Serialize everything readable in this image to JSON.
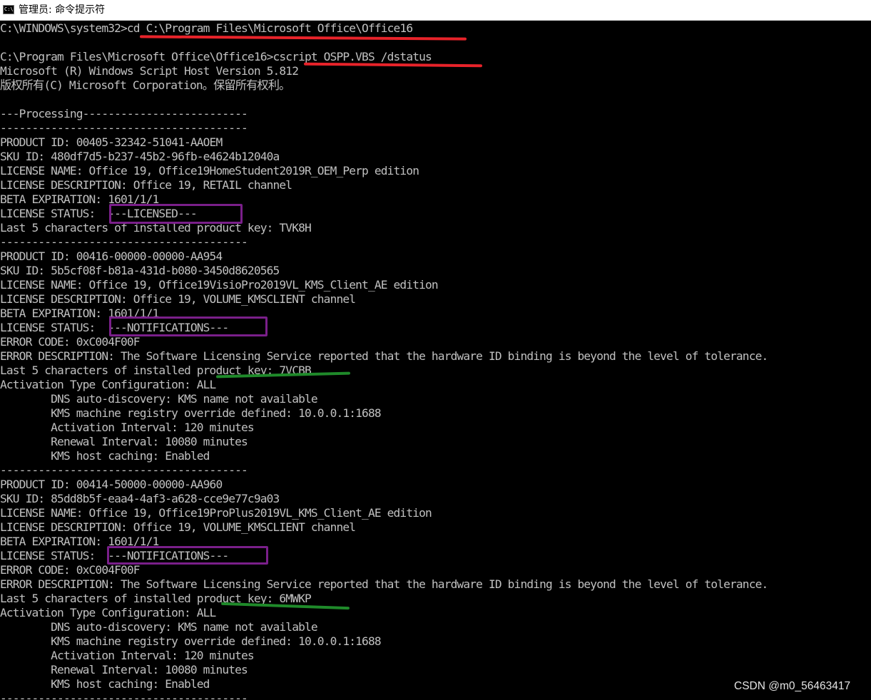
{
  "window": {
    "title": "管理员: 命令提示符",
    "icon_label": "C:\\.",
    "icon": "console-window-icon"
  },
  "console": {
    "lines": [
      "C:\\WINDOWS\\system32>cd C:\\Program Files\\Microsoft Office\\Office16",
      "",
      "C:\\Program Files\\Microsoft Office\\Office16>cscript OSPP.VBS /dstatus",
      "Microsoft (R) Windows Script Host Version 5.812",
      "版权所有(C) Microsoft Corporation。保留所有权利。",
      "",
      "---Processing--------------------------",
      "---------------------------------------",
      "PRODUCT ID: 00405-32342-51041-AAOEM",
      "SKU ID: 480df7d5-b237-45b2-96fb-e4624b12040a",
      "LICENSE NAME: Office 19, Office19HomeStudent2019R_OEM_Perp edition",
      "LICENSE DESCRIPTION: Office 19, RETAIL channel",
      "BETA EXPIRATION: 1601/1/1",
      "LICENSE STATUS:  ---LICENSED---",
      "Last 5 characters of installed product key: TVK8H",
      "---------------------------------------",
      "PRODUCT ID: 00416-00000-00000-AA954",
      "SKU ID: 5b5cf08f-b81a-431d-b080-3450d8620565",
      "LICENSE NAME: Office 19, Office19VisioPro2019VL_KMS_Client_AE edition",
      "LICENSE DESCRIPTION: Office 19, VOLUME_KMSCLIENT channel",
      "BETA EXPIRATION: 1601/1/1",
      "LICENSE STATUS:  ---NOTIFICATIONS---",
      "ERROR CODE: 0xC004F00F",
      "ERROR DESCRIPTION: The Software Licensing Service reported that the hardware ID binding is beyond the level of tolerance.",
      "Last 5 characters of installed product key: 7VCBB",
      "Activation Type Configuration: ALL",
      "        DNS auto-discovery: KMS name not available",
      "        KMS machine registry override defined: 10.0.0.1:1688",
      "        Activation Interval: 120 minutes",
      "        Renewal Interval: 10080 minutes",
      "        KMS host caching: Enabled",
      "---------------------------------------",
      "PRODUCT ID: 00414-50000-00000-AA960",
      "SKU ID: 85dd8b5f-eaa4-4af3-a628-cce9e77c9a03",
      "LICENSE NAME: Office 19, Office19ProPlus2019VL_KMS_Client_AE edition",
      "LICENSE DESCRIPTION: Office 19, VOLUME_KMSCLIENT channel",
      "BETA EXPIRATION: 1601/1/1",
      "LICENSE STATUS:  ---NOTIFICATIONS---",
      "ERROR CODE: 0xC004F00F",
      "ERROR DESCRIPTION: The Software Licensing Service reported that the hardware ID binding is beyond the level of tolerance.",
      "Last 5 characters of installed product key: 6MWKP",
      "Activation Type Configuration: ALL",
      "        DNS auto-discovery: KMS name not available",
      "        KMS machine registry override defined: 10.0.0.1:1688",
      "        Activation Interval: 120 minutes",
      "        Renewal Interval: 10080 minutes",
      "        KMS host caching: Enabled",
      "---------------------------------------"
    ]
  },
  "annotations": {
    "colors": {
      "underline_red": "#e8232a",
      "status_box_purple": "#7a1f8a",
      "underline_green": "#1f8a2a"
    }
  },
  "watermark": {
    "text": "CSDN @m0_56463417"
  },
  "colors": {
    "console_background": "#000000",
    "console_text": "#c0c0c0",
    "titlebar_background": "#ffffff"
  }
}
